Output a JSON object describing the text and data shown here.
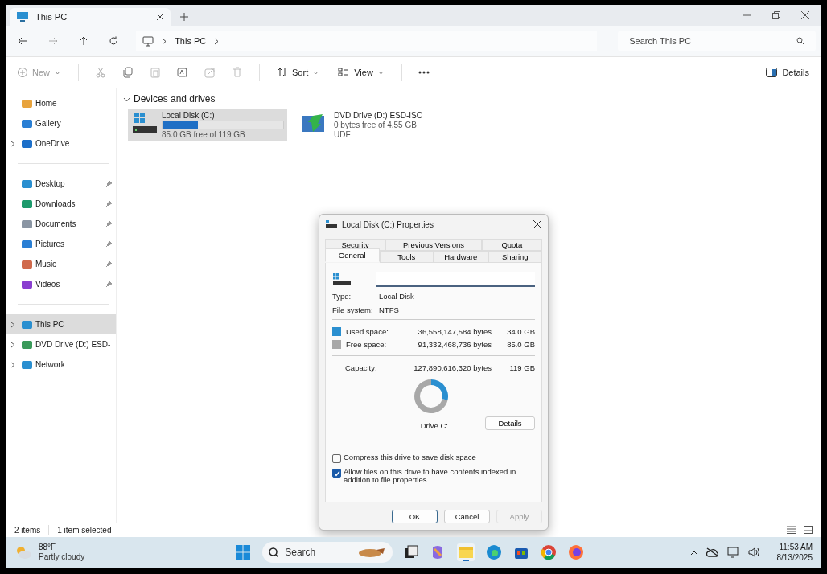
{
  "window": {
    "tab_title": "This PC"
  },
  "address": {
    "crumbs": [
      "This PC"
    ],
    "search_placeholder": "Search This PC"
  },
  "toolbar": {
    "new": {
      "label": "New",
      "disabled": true
    },
    "sort": "Sort",
    "view": "View",
    "details": "Details"
  },
  "sidebar": {
    "sections": [
      [
        {
          "label": "Home",
          "expandable": false,
          "pinned": false,
          "selected": false
        },
        {
          "label": "Gallery",
          "expandable": false,
          "pinned": false,
          "selected": false
        },
        {
          "label": "OneDrive",
          "expandable": true,
          "pinned": false,
          "selected": false
        }
      ],
      [
        {
          "label": "Desktop",
          "expandable": false,
          "pinned": true,
          "selected": false
        },
        {
          "label": "Downloads",
          "expandable": false,
          "pinned": true,
          "selected": false
        },
        {
          "label": "Documents",
          "expandable": false,
          "pinned": true,
          "selected": false
        },
        {
          "label": "Pictures",
          "expandable": false,
          "pinned": true,
          "selected": false
        },
        {
          "label": "Music",
          "expandable": false,
          "pinned": true,
          "selected": false
        },
        {
          "label": "Videos",
          "expandable": false,
          "pinned": true,
          "selected": false
        }
      ],
      [
        {
          "label": "This PC",
          "expandable": true,
          "pinned": false,
          "selected": true
        },
        {
          "label": "DVD Drive (D:) ESD-",
          "expandable": true,
          "pinned": false,
          "selected": false
        },
        {
          "label": "Network",
          "expandable": true,
          "pinned": false,
          "selected": false
        }
      ]
    ]
  },
  "group": {
    "title": "Devices and drives",
    "expanded": true
  },
  "drives": [
    {
      "kind": "disk",
      "name": "Local Disk (C:)",
      "selected": true,
      "level": 0.29,
      "lines": [
        "85.0 GB free of 119 GB"
      ]
    },
    {
      "kind": "dvd",
      "name": "DVD Drive (D:) ESD-ISO",
      "selected": false,
      "lines": [
        "0 bytes free of 4.55 GB",
        "UDF"
      ]
    }
  ],
  "status_bar": {
    "items": "2 items",
    "selection": "1 item selected"
  },
  "dialog": {
    "title": "Local Disk (C:) Properties",
    "tab_rows": [
      [
        {
          "label": "Security",
          "selected": false
        },
        {
          "label": "Previous Versions",
          "selected": false
        },
        {
          "label": "Quota",
          "selected": false
        }
      ],
      [
        {
          "label": "General",
          "selected": true
        },
        {
          "label": "Tools",
          "selected": false
        },
        {
          "label": "Hardware",
          "selected": false
        },
        {
          "label": "Sharing",
          "selected": false
        }
      ]
    ],
    "info": [
      {
        "label": "Type:",
        "value": "Local Disk"
      },
      {
        "label": "File system:",
        "value": "NTFS"
      }
    ],
    "space": [
      {
        "label": "Used space:",
        "bytes": "36,558,147,584 bytes",
        "size": "34.0 GB",
        "color": "#2a8fd0"
      },
      {
        "label": "Free space:",
        "bytes": "91,332,468,736 bytes",
        "size": "85.0 GB",
        "color": "#a8a8a8"
      }
    ],
    "capacity": {
      "label": "Capacity:",
      "bytes": "127,890,616,320 bytes",
      "size": "119 GB"
    },
    "chart_data": {
      "type": "donut",
      "values": [
        28.6,
        71.4
      ]
    },
    "drive_label": "Drive C:",
    "details_button": "Details",
    "options": [
      {
        "label": "Compress this drive to save disk space",
        "checked": false
      },
      {
        "label": "Allow files on this drive to have contents indexed in addition to file properties",
        "checked": true
      }
    ],
    "buttons": [
      {
        "label": "OK",
        "disabled": false,
        "default": true
      },
      {
        "label": "Cancel",
        "disabled": false,
        "default": false
      },
      {
        "label": "Apply",
        "disabled": true,
        "default": false
      }
    ]
  },
  "taskbar": {
    "temperature": "88°F",
    "condition": "Partly cloudy",
    "search_placeholder": "Search",
    "time": "11:53 AM",
    "date": "8/13/2025"
  }
}
